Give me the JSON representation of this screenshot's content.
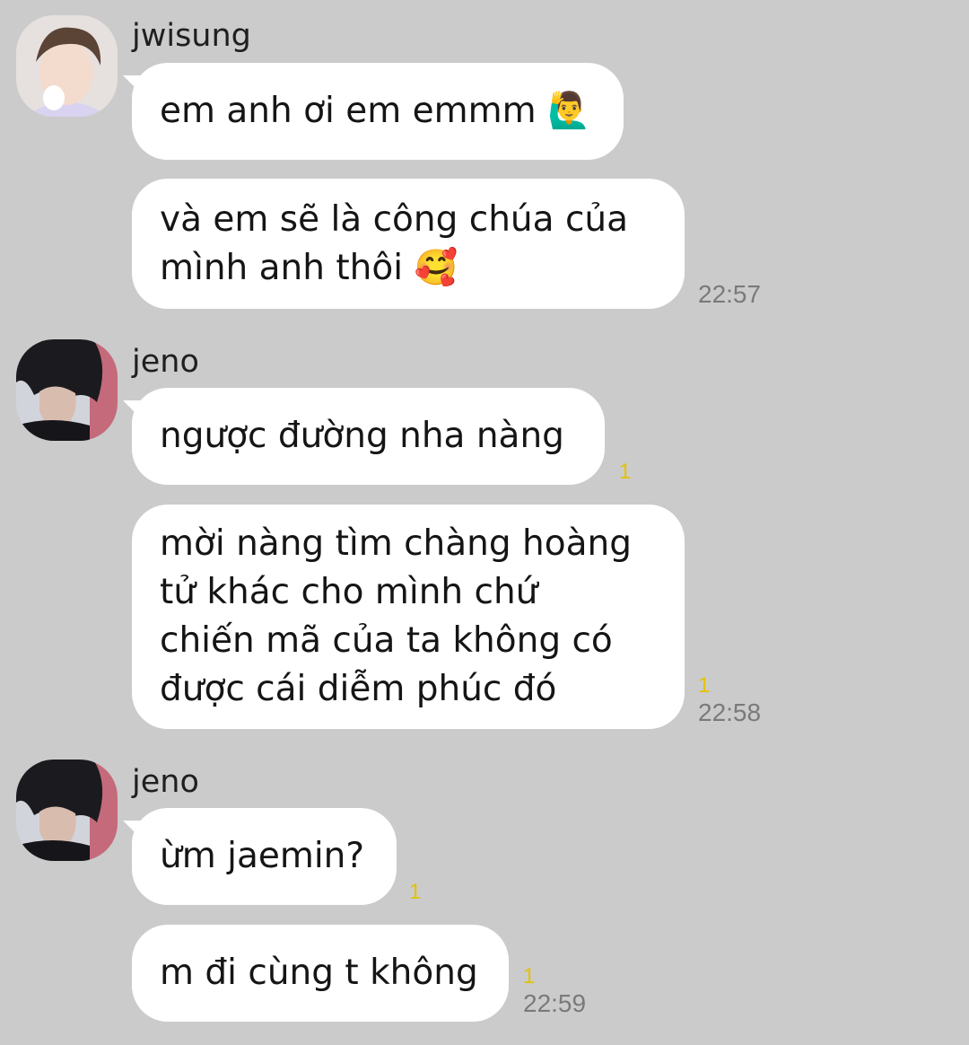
{
  "messages": [
    {
      "sender": "jwisung",
      "bubbles": [
        {
          "lines": [
            "em anh ơi em emmm 🙋‍♂️"
          ]
        },
        {
          "lines": [
            "và em sẽ là công chúa của",
            "mình anh thôi 🥰"
          ],
          "time": "22:57"
        }
      ]
    },
    {
      "sender": "jeno",
      "bubbles": [
        {
          "lines": [
            "ngược đường nha nàng"
          ],
          "unread": "1"
        },
        {
          "lines": [
            "mời nàng tìm chàng hoàng",
            "tử khác cho mình chứ",
            "chiến mã của ta không có",
            "được cái diễm phúc đó"
          ],
          "unread": "1",
          "time": "22:58"
        }
      ]
    },
    {
      "sender": "jeno",
      "bubbles": [
        {
          "lines": [
            "ừm jaemin?"
          ],
          "unread": "1"
        },
        {
          "lines": [
            "m đi cùng t không"
          ],
          "unread": "1",
          "time": "22:59"
        }
      ]
    }
  ],
  "colors": {
    "background": "#cbcbcb",
    "bubble": "#ffffff",
    "unread": "#e3c200",
    "time": "#7a7a7a"
  }
}
